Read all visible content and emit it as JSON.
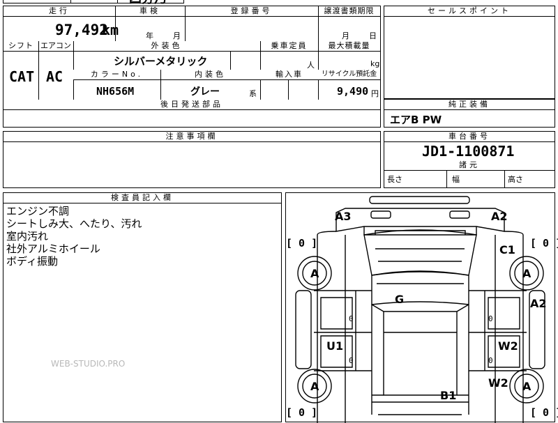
{
  "top_partial": {
    "model_cut": "四分乃"
  },
  "headers": {
    "mileage": "走行",
    "inspection": "車検",
    "registration": "登録番号",
    "transfer_deadline": "譲渡書類期限",
    "sales_point": "セールスポイント",
    "shift": "シフト",
    "aircon": "エアコン",
    "exterior_color": "外装色",
    "capacity": "乗車定員",
    "max_load": "最大積載量",
    "color_no": "カラーNo.",
    "interior_color": "内装色",
    "import": "輸入車",
    "recycle": "リサイクル預託金",
    "later_parts": "後日発送部品",
    "equipment": "純正装備",
    "cautions": "注意事項欄",
    "chassis_no": "車台番号",
    "dimensions": "諸元",
    "inspector_notes": "検査員記入欄"
  },
  "values": {
    "mileage": "97,492",
    "mileage_unit": "km",
    "inspection_year": "年",
    "inspection_month": "月",
    "transfer_month": "月",
    "transfer_day": "日",
    "shift": "CAT",
    "aircon": "AC",
    "exterior_color": "シルバーメタリック",
    "capacity_unit": "人",
    "load_unit": "kg",
    "color_no": "NH656M",
    "interior_color": "グレー",
    "interior_suffix": "系",
    "recycle": "9,490",
    "recycle_unit": "円",
    "equipment": "エアB PW",
    "chassis_no": "JD1-1100871",
    "length_label": "長さ",
    "width_label": "幅",
    "height_label": "高さ"
  },
  "inspector_notes": [
    "エンジン不調",
    "シートしみ大、へたり、汚れ",
    "室内汚れ",
    "社外アルミホイール",
    "ボディ振動"
  ],
  "watermark": "WEB-STUDIO.PRO",
  "diagram": {
    "marks": {
      "front_left_corner": "A3",
      "front_right_corner": "A2",
      "right_fender": "C1",
      "right_front_door": "A2",
      "roof": "G",
      "left_rear_door": "U1",
      "right_rear_door": "W2",
      "right_quarter": "W2",
      "rear": "B1"
    },
    "tires": {
      "front_left": "A",
      "front_right": "A",
      "rear_left": "A",
      "rear_right": "A"
    },
    "tread": {
      "front_left": "[ 0 ]",
      "front_right": "[ 0 ]",
      "rear_left": "[ 0 ]",
      "rear_right": "[ 0 ]"
    },
    "small_zero": "0"
  }
}
